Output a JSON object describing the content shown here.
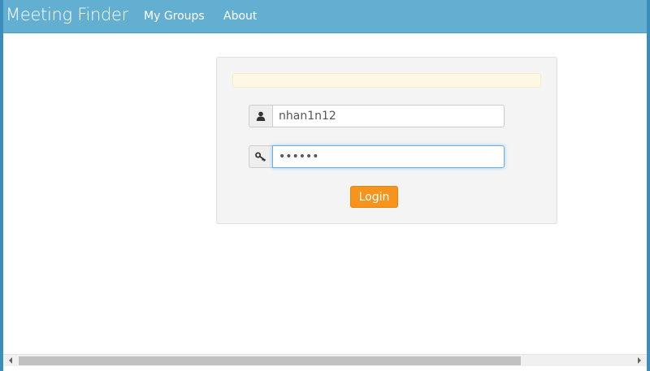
{
  "navbar": {
    "brand": "Meeting Finder",
    "links": [
      {
        "label": "My Groups"
      },
      {
        "label": "About"
      }
    ],
    "color": "#62afd2"
  },
  "login": {
    "username_value": "nhan1n12",
    "password_value": "••••••",
    "button_label": "Login",
    "button_color": "#f7941d"
  },
  "icons": {
    "username": "user-icon",
    "password": "key-icon"
  }
}
